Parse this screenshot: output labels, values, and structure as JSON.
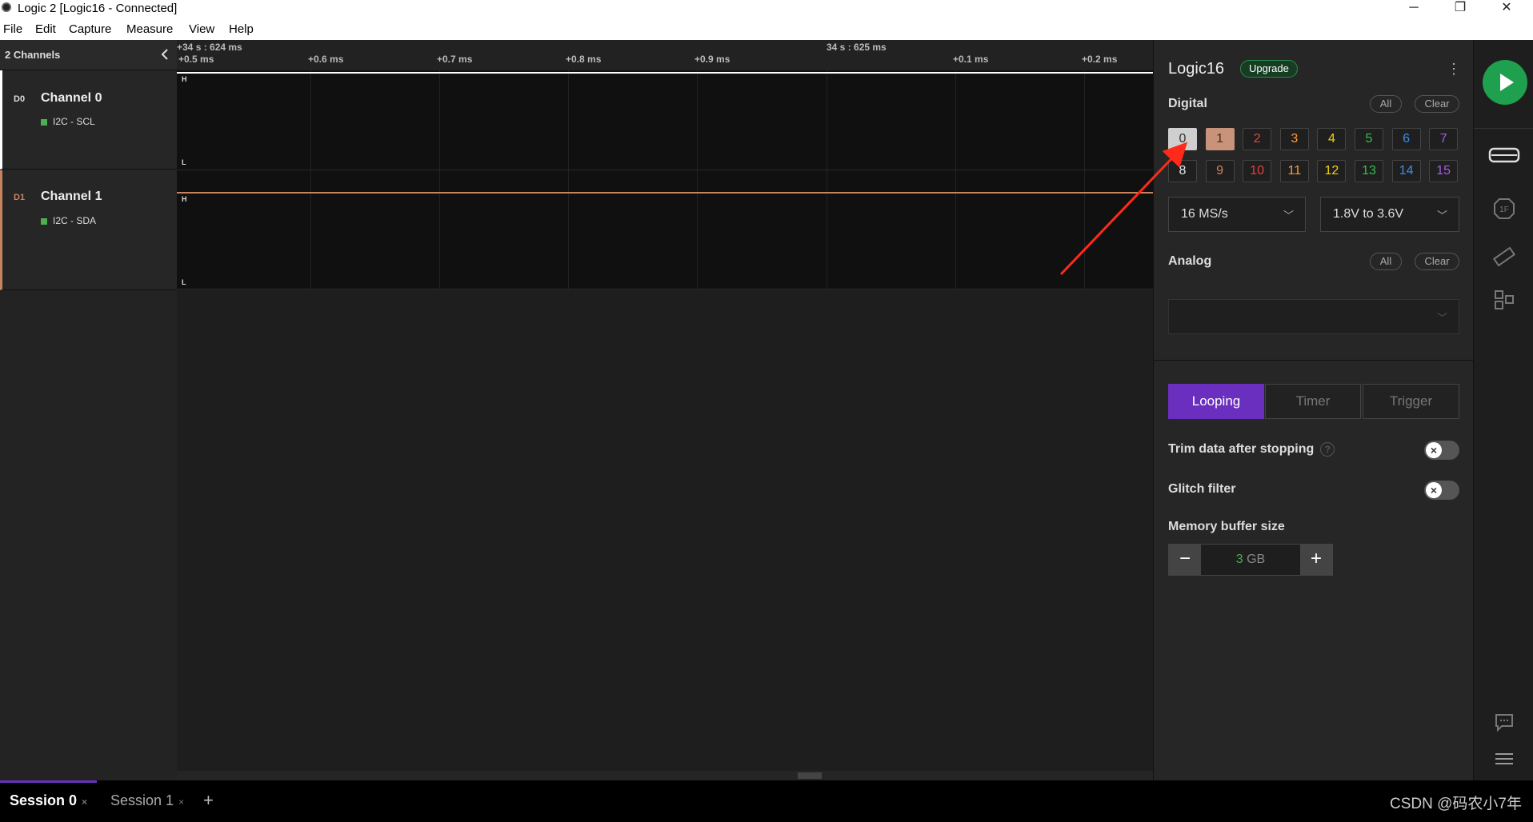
{
  "window": {
    "title": "Logic 2 [Logic16 - Connected]",
    "controls": [
      "─",
      "❐",
      "✕"
    ]
  },
  "menu": [
    "File",
    "Edit",
    "Capture",
    "Measure",
    "View",
    "Help"
  ],
  "channels_panel": {
    "header": "2 Channels",
    "channels": [
      {
        "tag": "D0",
        "name": "Channel 0",
        "analyzer": "I2C - SCL",
        "color": "#ffffff"
      },
      {
        "tag": "D1",
        "name": "Channel 1",
        "analyzer": "I2C - SDA",
        "color": "#c8845f"
      }
    ]
  },
  "timeline": {
    "ticks": [
      "+0.5 ms",
      "+0.6 ms",
      "+0.7 ms",
      "+0.8 ms",
      "+0.9 ms",
      "34 s : 625 ms",
      "+0.1 ms",
      "+0.2 ms"
    ],
    "start_marker": "+34 s : 624 ms",
    "high_label": "H",
    "low_label": "L"
  },
  "device": {
    "name": "Logic16",
    "upgrade_label": "Upgrade",
    "menu_icon": "kebab-icon",
    "digital_label": "Digital",
    "all_label": "All",
    "clear_label": "Clear",
    "digital_channels": [
      {
        "num": "0",
        "color": "#cfcfcf",
        "bg": "#cfcfcf",
        "text": "#333333",
        "enabled": true
      },
      {
        "num": "1",
        "color": "#c8845f",
        "bg": "#c8937a",
        "text": "#4a2a1a",
        "enabled": true
      },
      {
        "num": "2",
        "color": "#e0453a",
        "enabled": false
      },
      {
        "num": "3",
        "color": "#ff9a3c",
        "enabled": false
      },
      {
        "num": "4",
        "color": "#f2d10a",
        "enabled": false
      },
      {
        "num": "5",
        "color": "#35c04a",
        "enabled": false
      },
      {
        "num": "6",
        "color": "#3d8ee8",
        "enabled": false
      },
      {
        "num": "7",
        "color": "#a45de6",
        "enabled": false
      },
      {
        "num": "8",
        "color": "#e6e6e6",
        "enabled": false
      },
      {
        "num": "9",
        "color": "#c8845f",
        "enabled": false
      },
      {
        "num": "10",
        "color": "#e0453a",
        "enabled": false
      },
      {
        "num": "11",
        "color": "#ff9a3c",
        "enabled": false
      },
      {
        "num": "12",
        "color": "#f2d10a",
        "enabled": false
      },
      {
        "num": "13",
        "color": "#35c04a",
        "enabled": false
      },
      {
        "num": "14",
        "color": "#3d8ee8",
        "enabled": false
      },
      {
        "num": "15",
        "color": "#a45de6",
        "enabled": false
      }
    ],
    "sample_rate": "16 MS/s",
    "voltage": "1.8V to 3.6V",
    "analog_label": "Analog",
    "analog_rate": "",
    "modes": [
      "Looping",
      "Timer",
      "Trigger"
    ],
    "active_mode": "Looping",
    "trim_label": "Trim data after stopping",
    "trim_help": "?",
    "trim_enabled": false,
    "glitch_label": "Glitch filter",
    "glitch_enabled": false,
    "memory_label": "Memory buffer size",
    "memory_value": "3",
    "memory_unit": "GB"
  },
  "sessions": {
    "tabs": [
      {
        "label": "Session 0",
        "close": "×",
        "active": true
      },
      {
        "label": "Session 1",
        "close": "×",
        "active": false
      }
    ],
    "add_label": "+"
  },
  "watermark": "CSDN @码农小7年",
  "colors": {
    "accent": "#6b2fc0",
    "play": "#1fa04f",
    "arrow": "#ff2a1a"
  }
}
